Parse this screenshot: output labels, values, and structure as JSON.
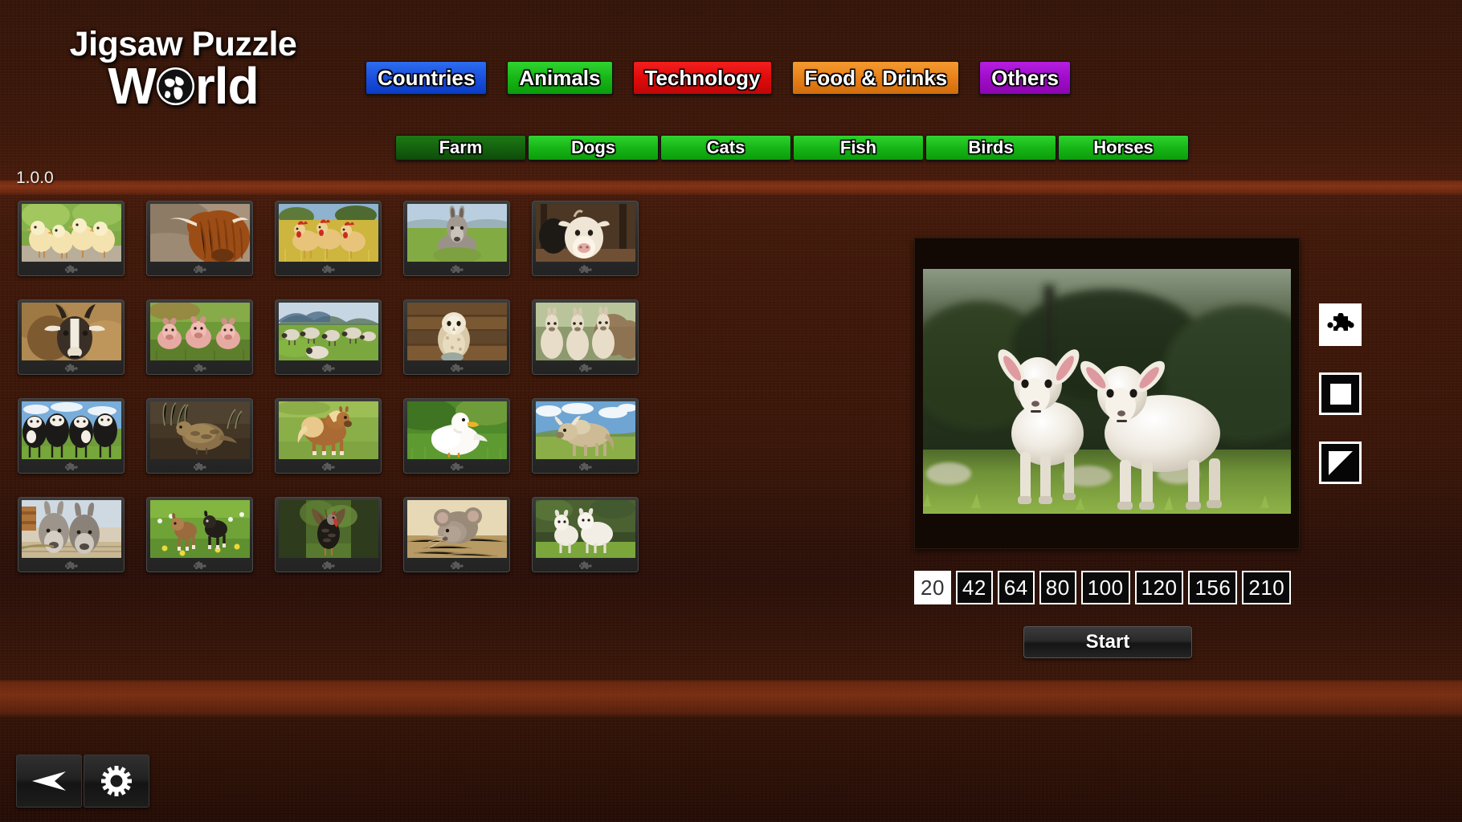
{
  "app": {
    "title_line1": "Jigsaw Puzzle",
    "title_line2a": "W",
    "title_line2b": "rld",
    "globe_icon": "globe-icon",
    "version": "1.0.0"
  },
  "nav": {
    "main": [
      {
        "label": "Countries",
        "color": "#1a50dd",
        "theme": "c-blue",
        "selected": false
      },
      {
        "label": "Animals",
        "color": "#17b617",
        "theme": "c-green",
        "selected": true
      },
      {
        "label": "Technology",
        "color": "#e00b0b",
        "theme": "c-red",
        "selected": false
      },
      {
        "label": "Food & Drinks",
        "color": "#e8811a",
        "theme": "c-orange",
        "selected": false
      },
      {
        "label": "Others",
        "color": "#a10ccb",
        "theme": "c-purple",
        "selected": false
      }
    ],
    "sub": [
      {
        "label": "Farm",
        "theme": "c-greendark",
        "selected": true
      },
      {
        "label": "Dogs",
        "theme": "c-green",
        "selected": false
      },
      {
        "label": "Cats",
        "theme": "c-green",
        "selected": false
      },
      {
        "label": "Fish",
        "theme": "c-green",
        "selected": false
      },
      {
        "label": "Birds",
        "theme": "c-green",
        "selected": false
      },
      {
        "label": "Horses",
        "theme": "c-green",
        "selected": false
      }
    ]
  },
  "gallery": {
    "icon": "puzzle-piece-icon",
    "thumbnails": [
      {
        "name": "chicks",
        "alt": "Four yellow chicks on gravel"
      },
      {
        "name": "highland-cow",
        "alt": "Highland cow with long horns"
      },
      {
        "name": "hens",
        "alt": "Hens in a yellow field"
      },
      {
        "name": "donkey-foal",
        "alt": "Donkey resting in green pasture"
      },
      {
        "name": "calf-barn",
        "alt": "Calf in a barn"
      },
      {
        "name": "goat",
        "alt": "Brown and white goat portrait"
      },
      {
        "name": "piglets",
        "alt": "Three piglets in grass"
      },
      {
        "name": "sheep-flock",
        "alt": "Flock of sheep on hillside"
      },
      {
        "name": "barn-owl",
        "alt": "Barn owl against wooden wall"
      },
      {
        "name": "alpacas",
        "alt": "Group of alpacas"
      },
      {
        "name": "dairy-cows",
        "alt": "Black and white dairy cows"
      },
      {
        "name": "quail",
        "alt": "Quail on the ground"
      },
      {
        "name": "shetland-pony",
        "alt": "Shetland pony in meadow"
      },
      {
        "name": "white-duck",
        "alt": "White duck on grass"
      },
      {
        "name": "zebu-ox",
        "alt": "Horned ox on a ridge"
      },
      {
        "name": "donkeys",
        "alt": "Two donkeys at a fence"
      },
      {
        "name": "kid-goats",
        "alt": "Two kid goats running"
      },
      {
        "name": "turkey",
        "alt": "Turkey displaying feathers"
      },
      {
        "name": "mouse",
        "alt": "Mouse on straw"
      },
      {
        "name": "lambs",
        "alt": "Two lambs in a field"
      }
    ]
  },
  "preview": {
    "name": "lambs-preview",
    "alt": "Two white lambs standing in green grass"
  },
  "piece_counts": {
    "options": [
      "20",
      "42",
      "64",
      "80",
      "100",
      "120",
      "156",
      "210"
    ],
    "selected": "20"
  },
  "start": {
    "label": "Start"
  },
  "modes": [
    {
      "name": "jigsaw-cut-mode",
      "icon": "puzzle-piece-icon",
      "selected": true
    },
    {
      "name": "square-cut-mode",
      "icon": "square-icon",
      "selected": false
    },
    {
      "name": "triangle-cut-mode",
      "icon": "triangle-icon",
      "selected": false
    }
  ],
  "bottom_bar": [
    {
      "name": "back-button",
      "icon": "back-arrow-icon"
    },
    {
      "name": "settings-button",
      "icon": "gear-icon"
    }
  ],
  "colors": {
    "wood_dark": "#3a1508",
    "wood_plank": "#a8421a",
    "accent_green": "#17b617",
    "selected_white": "#ffffff"
  }
}
